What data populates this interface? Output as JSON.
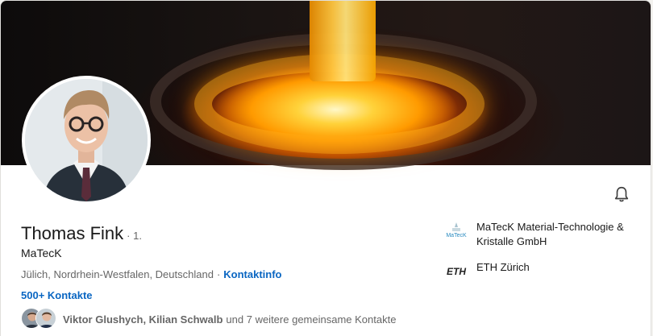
{
  "profile": {
    "name": "Thomas Fink",
    "degree": "· 1.",
    "headline": "MaTecK",
    "location": "Jülich, Nordrhein-Westfalen, Deutschland",
    "separator": "·",
    "contact_info_label": "Kontaktinfo",
    "connections_label": "500+ Kontakte",
    "mutual_names": "Viktor Glushych, Kilian Schwalb",
    "mutual_rest": "und 7 weitere gemeinsame Kontakte"
  },
  "companies": [
    {
      "name": "MaTecK Material-Technologie & Kristalle GmbH",
      "logo_text": "MaTecK"
    },
    {
      "name": "ETH Zürich",
      "logo_text": "ETH"
    }
  ],
  "icons": {
    "bell": "bell-icon"
  },
  "colors": {
    "link": "#0a66c2",
    "text": "#191919",
    "muted": "#666666"
  }
}
